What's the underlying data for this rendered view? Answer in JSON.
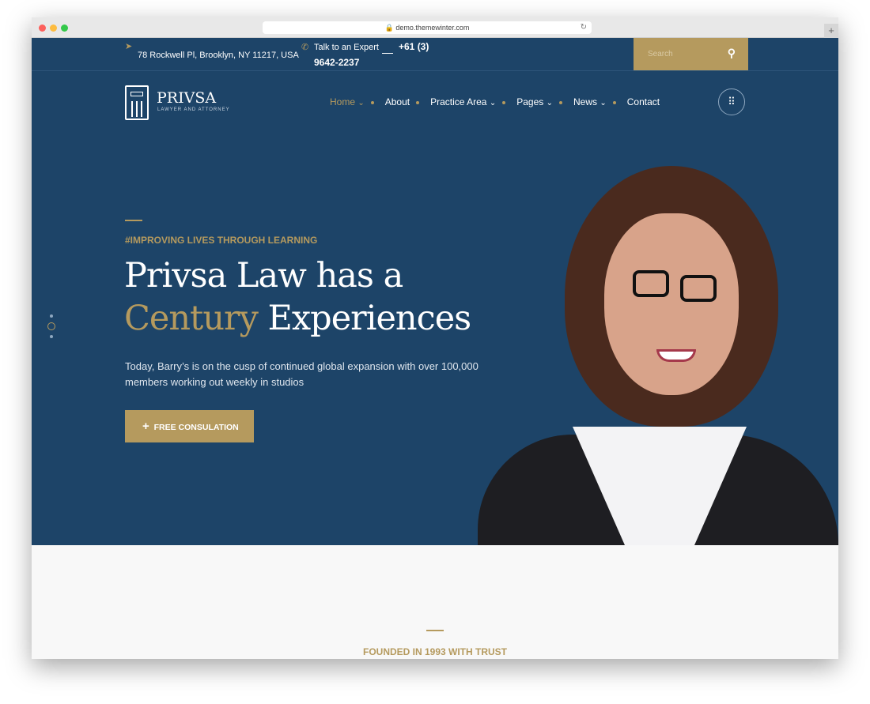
{
  "browser": {
    "url": "demo.themewinter.com"
  },
  "topbar": {
    "address": "78 Rockwell Pl, Brooklyn, NY 11217, USA",
    "expert_label": "Talk to an Expert",
    "phone_a": "+61 (3)",
    "phone_b": "9642-2237",
    "search_placeholder": "Search"
  },
  "brand": {
    "name": "PRIVSA",
    "tagline": "LAWYER AND ATTORNEY"
  },
  "nav": {
    "items": [
      {
        "label": "Home",
        "dropdown": true
      },
      {
        "label": "About"
      },
      {
        "label": "Practice Area",
        "dropdown": true
      },
      {
        "label": "Pages",
        "dropdown": true
      },
      {
        "label": "News",
        "dropdown": true
      },
      {
        "label": "Contact"
      }
    ]
  },
  "hero": {
    "eyebrow": "#IMPROVING LIVES THROUGH LEARNING",
    "title_line1": "Privsa Law has a",
    "title_accent": "Century",
    "title_rest": " Experiences",
    "description": "Today, Barry’s is on the cusp of continued global expansion with over 100,000 members working out weekly in studios",
    "cta": "FREE CONSULATION"
  },
  "section": {
    "eyebrow": "FOUNDED IN 1993 WITH TRUST"
  },
  "colors": {
    "navy": "#1d4468",
    "gold": "#b59a5e"
  }
}
